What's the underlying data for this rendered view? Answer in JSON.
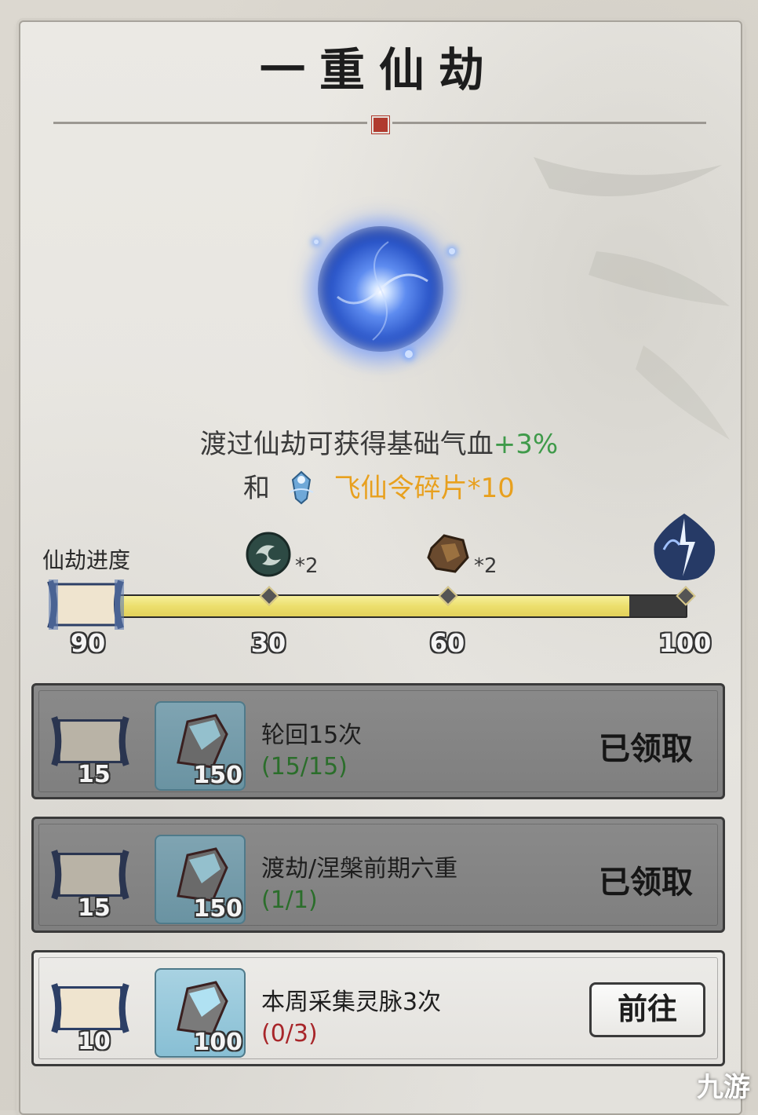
{
  "title": "一重仙劫",
  "description": {
    "line1_text": "渡过仙劫可获得基础气血",
    "line1_bonus": "+3%",
    "line2_prefix": "和",
    "line2_reward": "飞仙令碎片*10"
  },
  "progress": {
    "label": "仙劫进度",
    "current": "90",
    "max": 100,
    "fill_fraction": 0.9,
    "milestones": [
      {
        "value": "30",
        "reward_mult": "*2",
        "icon": "jade-coin-icon"
      },
      {
        "value": "60",
        "reward_mult": "*2",
        "icon": "ore-stone-icon"
      },
      {
        "value": "100",
        "reward_mult": "",
        "icon": "lightning-flame-icon"
      }
    ]
  },
  "tasks": [
    {
      "title": "轮回15次",
      "progress": "(15/15)",
      "points": "15",
      "reward_amount": "150",
      "status": "已领取",
      "state": "claimed"
    },
    {
      "title": "渡劫/涅槃前期六重",
      "progress": "(1/1)",
      "points": "15",
      "reward_amount": "150",
      "status": "已领取",
      "state": "claimed"
    },
    {
      "title": "本周采集灵脉3次",
      "progress": "(0/3)",
      "points": "10",
      "reward_amount": "100",
      "status": "前往",
      "state": "go"
    }
  ],
  "watermark": "九游",
  "colors": {
    "bonus_green": "#3f9a4a",
    "reward_orange": "#e8a01e",
    "progress_yellow": "#ecdf6d",
    "incomplete_red": "#a8262a"
  }
}
